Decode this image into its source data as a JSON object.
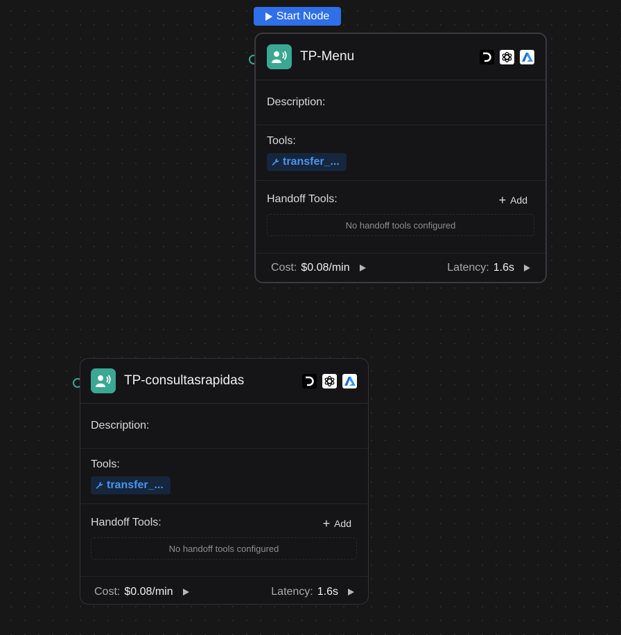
{
  "start_badge": {
    "label": "Start Node"
  },
  "nodes": [
    {
      "title": "TP-Menu",
      "description_label": "Description:",
      "tools_label": "Tools:",
      "tool_chip": "transfer_...",
      "handoff_label": "Handoff Tools:",
      "add_label": "Add",
      "empty_text": "No handoff tools configured",
      "cost_label": "Cost:",
      "cost_value": "$0.08/min",
      "latency_label": "Latency:",
      "latency_value": "1.6s"
    },
    {
      "title": "TP-consultasrapidas",
      "description_label": "Description:",
      "tools_label": "Tools:",
      "tool_chip": "transfer_...",
      "handoff_label": "Handoff Tools:",
      "add_label": "Add",
      "empty_text": "No handoff tools configured",
      "cost_label": "Cost:",
      "cost_value": "$0.08/min",
      "latency_label": "Latency:",
      "latency_value": "1.6s"
    }
  ],
  "icons": {
    "agent": "voice-agent-icon",
    "providers": [
      "deepgram-icon",
      "openai-icon",
      "azure-icon"
    ],
    "tool": "wrench-icon"
  },
  "colors": {
    "accent": "#2f6fe8",
    "agent_teal": "#3aa892",
    "tool_blue": "#4a94ec",
    "canvas": "#171718"
  }
}
